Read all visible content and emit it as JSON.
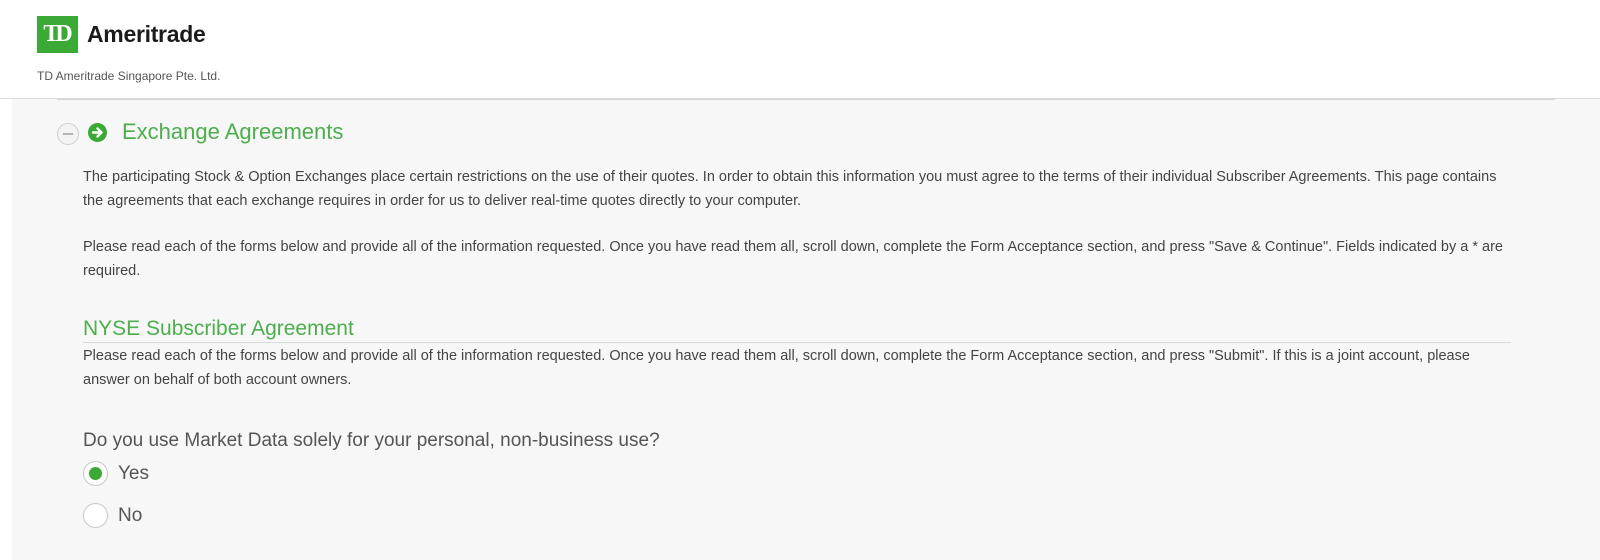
{
  "header": {
    "logo_mark": "TD",
    "brand_name": "Ameritrade",
    "entity_name": "TD Ameritrade Singapore Pte. Ltd."
  },
  "section": {
    "title": "Exchange Agreements",
    "intro_1": "The participating Stock & Option Exchanges place certain restrictions on the use of their quotes. In order to obtain this information you must agree to the terms of their individual Subscriber Agreements. This page contains the agreements that each exchange requires in order for us to deliver real-time quotes directly to your computer.",
    "intro_2": "Please read each of the forms below and provide all of the information requested. Once you have read them all, scroll down, complete the Form Acceptance section, and press \"Save & Continue\". Fields indicated by a * are required."
  },
  "agreement": {
    "title": "NYSE Subscriber Agreement",
    "text": "Please read each of the forms below and provide all of the information requested. Once you have read them all, scroll down, complete the Form Acceptance section, and press \"Submit\". If this is a joint account, please answer on behalf of both account owners.",
    "question": "Do you use Market Data solely for your personal, non-business use?",
    "options": [
      {
        "label": "Yes",
        "selected": true
      },
      {
        "label": "No",
        "selected": false
      }
    ]
  },
  "colors": {
    "brand_green": "#3aa935",
    "heading_green": "#4cae4c",
    "panel_bg": "#f7f7f7"
  },
  "icons": [
    "collapse-icon",
    "arrow-circle-right-icon",
    "radio-selected-icon",
    "radio-unselected-icon"
  ]
}
